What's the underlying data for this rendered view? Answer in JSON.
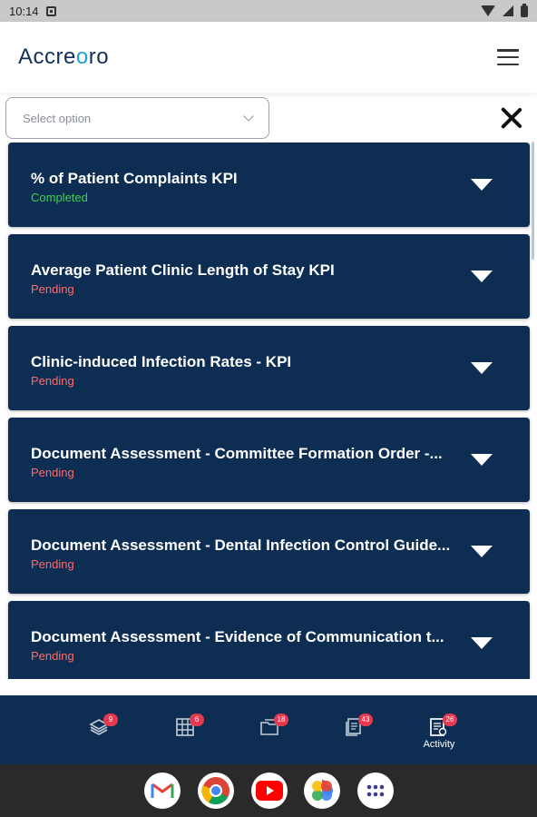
{
  "status_bar": {
    "time": "10:14"
  },
  "header": {
    "logo_prefix": "Accre",
    "logo_mark": "o",
    "logo_suffix": "ro"
  },
  "filter": {
    "placeholder": "Select option"
  },
  "items": [
    {
      "title": "% of Patient Complaints KPI",
      "status": "Completed"
    },
    {
      "title": "Average Patient Clinic Length of Stay KPI",
      "status": "Pending"
    },
    {
      "title": "Clinic-induced Infection Rates - KPI",
      "status": "Pending"
    },
    {
      "title": "Document Assessment - Committee Formation Order -...",
      "status": "Pending"
    },
    {
      "title": "Document Assessment - Dental Infection Control Guide...",
      "status": "Pending"
    },
    {
      "title": "Document Assessment - Evidence of Communication t...",
      "status": "Pending"
    }
  ],
  "bottom_nav": [
    {
      "icon": "stack-icon",
      "badge": "9"
    },
    {
      "icon": "grid-icon",
      "badge": "6"
    },
    {
      "icon": "folder-icon",
      "badge": "18"
    },
    {
      "icon": "documents-icon",
      "badge": "43"
    },
    {
      "icon": "activity-icon",
      "badge": "26",
      "label": "Activity"
    }
  ],
  "dock": [
    "gmail-icon",
    "chrome-icon",
    "youtube-icon",
    "photos-icon",
    "app-drawer-icon"
  ],
  "colors": {
    "navy": "#0d2d52",
    "completed": "#3fd14f",
    "pending": "#ff6b6b",
    "badge": "#e6394f",
    "logo_accent": "#1aa3d9"
  }
}
